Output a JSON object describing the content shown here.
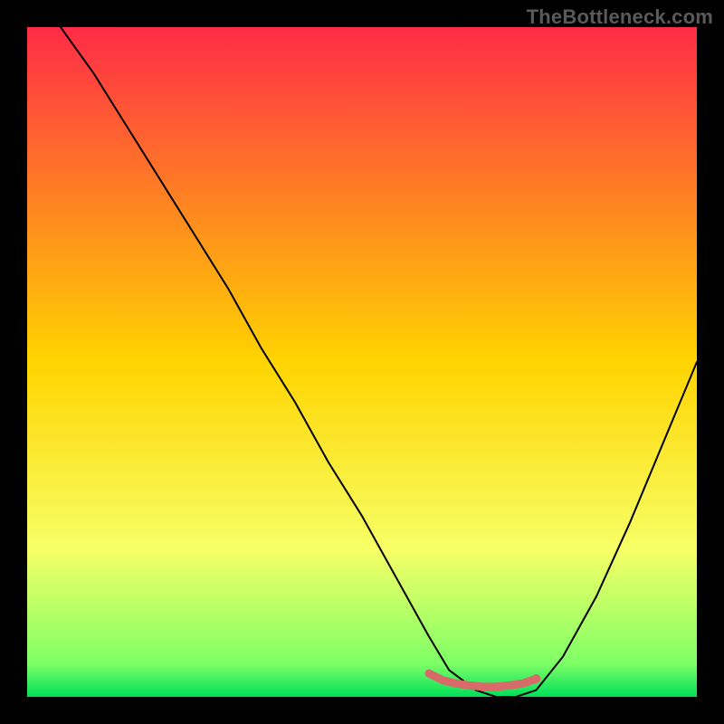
{
  "watermark": "TheBottleneck.com",
  "chart_data": {
    "type": "line",
    "title": "",
    "xlabel": "",
    "ylabel": "",
    "xlim": [
      0,
      100
    ],
    "ylim": [
      0,
      100
    ],
    "background_gradient": {
      "stops": [
        {
          "offset": 0,
          "color": "#ff2b47"
        },
        {
          "offset": 50,
          "color": "#ffd400"
        },
        {
          "offset": 78,
          "color": "#f7ff66"
        },
        {
          "offset": 95,
          "color": "#7fff66"
        },
        {
          "offset": 100,
          "color": "#00e05a"
        }
      ]
    },
    "curve": {
      "color": "#000000",
      "width": 2,
      "x": [
        5,
        10,
        15,
        20,
        25,
        30,
        35,
        40,
        45,
        50,
        55,
        60,
        63,
        67,
        70,
        73,
        76,
        80,
        85,
        90,
        95,
        100
      ],
      "y": [
        100,
        93,
        85,
        77,
        69,
        61,
        52,
        44,
        35,
        27,
        18,
        9,
        4,
        1,
        0,
        0,
        1,
        6,
        15,
        26,
        38,
        50
      ]
    },
    "marker_band": {
      "color": "#d86a6a",
      "radius_end": 5,
      "x": [
        60,
        62,
        64,
        66,
        68,
        70,
        72,
        74,
        76
      ],
      "y": [
        3.5,
        2.5,
        2.0,
        1.7,
        1.5,
        1.5,
        1.7,
        2.0,
        2.7
      ]
    }
  }
}
